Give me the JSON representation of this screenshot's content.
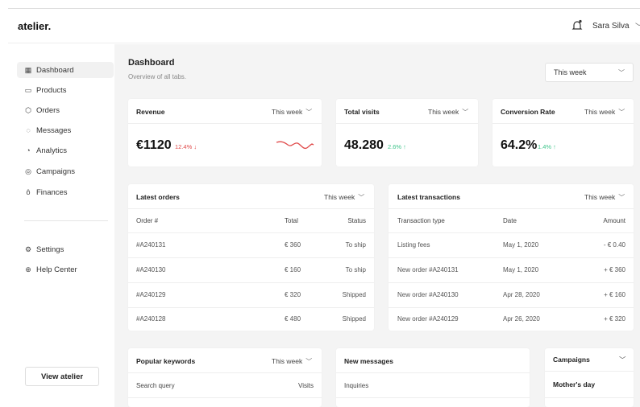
{
  "app": {
    "logo": "atelier.",
    "user": "Sara Silva"
  },
  "sidebar": {
    "items": [
      {
        "label": "Dashboard",
        "icon": "grid-icon"
      },
      {
        "label": "Products",
        "icon": "box-icon"
      },
      {
        "label": "Orders",
        "icon": "package-icon"
      },
      {
        "label": "Messages",
        "icon": "chat-icon"
      },
      {
        "label": "Analytics",
        "icon": "analytics-icon"
      },
      {
        "label": "Campaigns",
        "icon": "target-icon"
      },
      {
        "label": "Finances",
        "icon": "moneybag-icon"
      }
    ],
    "bottom": [
      {
        "label": "Settings",
        "icon": "gear-icon"
      },
      {
        "label": "Help Center",
        "icon": "globe-icon"
      }
    ],
    "view_button": "View atelier"
  },
  "header": {
    "title": "Dashboard",
    "subtitle": "Overview of all tabs.",
    "period": "This week"
  },
  "stats": {
    "revenue": {
      "title": "Revenue",
      "period": "This week",
      "value": "€1120",
      "change": "12.4% ↓"
    },
    "visits": {
      "title": "Total visits",
      "period": "This week",
      "value": "48.280",
      "change": "2.6% ↑"
    },
    "conversion": {
      "title": "Conversion Rate",
      "period": "This week",
      "value": "64.2%",
      "change": "1.4% ↑"
    }
  },
  "orders": {
    "title": "Latest orders",
    "period": "This week",
    "headers": [
      "Order #",
      "Total",
      "Status"
    ],
    "rows": [
      [
        "#A240131",
        "€ 360",
        "To ship"
      ],
      [
        "#A240130",
        "€ 160",
        "To ship"
      ],
      [
        "#A240129",
        "€ 320",
        "Shipped"
      ],
      [
        "#A240128",
        "€ 480",
        "Shipped"
      ]
    ]
  },
  "transactions": {
    "title": "Latest transactions",
    "period": "This week",
    "headers": [
      "Transaction type",
      "Date",
      "Amount"
    ],
    "rows": [
      [
        "Listing fees",
        "May 1, 2020",
        "- € 0.40"
      ],
      [
        "New order #A240131",
        "May 1, 2020",
        "+ € 360"
      ],
      [
        "New order #A240130",
        "Apr 28, 2020",
        "+ € 160"
      ],
      [
        "New order #A240129",
        "Apr 26, 2020",
        "+ € 320"
      ]
    ]
  },
  "keywords": {
    "title": "Popular keywords",
    "period": "This week",
    "headers": [
      "Search query",
      "Visits"
    ]
  },
  "messages": {
    "title": "New messages",
    "headers": [
      "Inquiries"
    ]
  },
  "campaigns": {
    "title": "Campaigns",
    "item": "Mother's day"
  },
  "colors": {
    "negative": "#e04a4a",
    "positive": "#3ec48a"
  }
}
